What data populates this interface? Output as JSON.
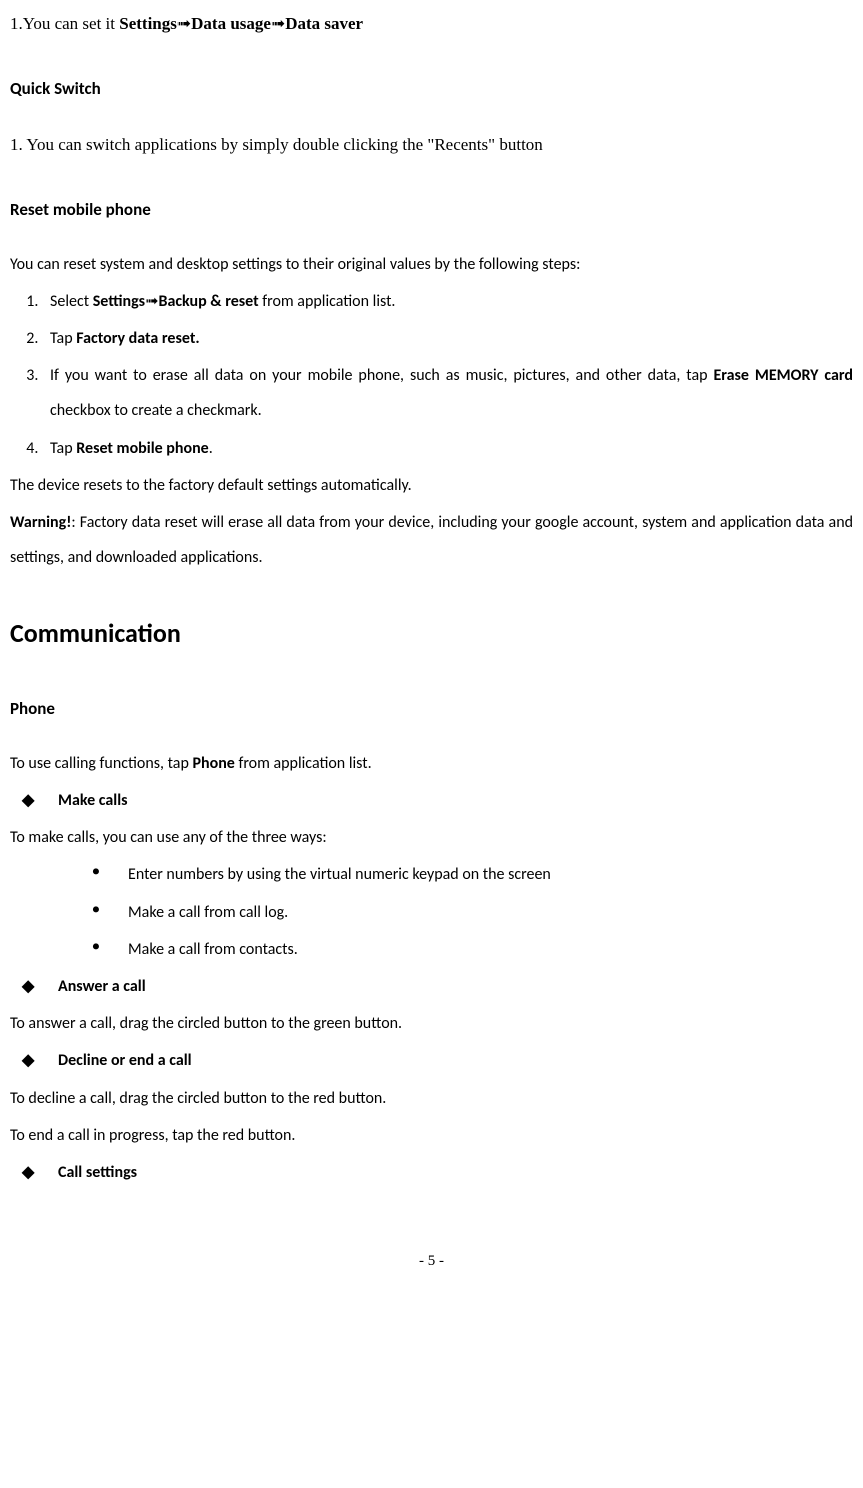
{
  "line1_prefix": "1.You can set it ",
  "line1_b1": "Settings",
  "line1_b2": "Data usage",
  "line1_b3": "Data saver",
  "quickSwitch": {
    "heading": "Quick Switch",
    "line1": "1. You can switch applications by simply double clicking the \"Recents\" button"
  },
  "reset": {
    "heading": "Reset mobile phone",
    "intro": "You can reset system and desktop settings to their original values by the following steps:",
    "step1_pre": "Select ",
    "step1_b1": "Settings",
    "step1_b2": "Backup & reset",
    "step1_post": " from application list.",
    "step2_pre": "Tap ",
    "step2_b": "Factory data reset.",
    "step3_pre": "If you want to erase all data on your mobile phone, such as music, pictures, and other data, tap ",
    "step3_b": "Erase MEMORY card",
    "step3_post": " checkbox to create a checkmark.",
    "step4_pre": "Tap ",
    "step4_b": "Reset mobile phone",
    "step4_post": ".",
    "after": "The device resets to the factory default settings automatically.",
    "warning_b": "Warning!",
    "warning_text": ": Factory data reset will erase all data from your device, including your google account, system and application data and settings, and downloaded applications."
  },
  "comm": {
    "heading": "Communication",
    "phone_heading": "Phone",
    "phone_intro_pre": "To use calling functions, tap ",
    "phone_intro_b": "Phone",
    "phone_intro_post": " from application list.",
    "make_calls": "Make calls",
    "make_calls_intro": "To make calls, you can use any of the three ways:",
    "way1": "Enter numbers by using the virtual numeric keypad on the screen",
    "way2": "Make a call from call log.",
    "way3": "Make a call from contacts.",
    "answer_call": "Answer a call",
    "answer_text": "To answer a call, drag the circled button to the green button.",
    "decline_call": "Decline or end a call",
    "decline_text": "To decline a call, drag the circled button to the red button.",
    "end_text": "To end a call in progress, tap the red button.",
    "call_settings": "Call settings"
  },
  "page_number": "- 5 -"
}
